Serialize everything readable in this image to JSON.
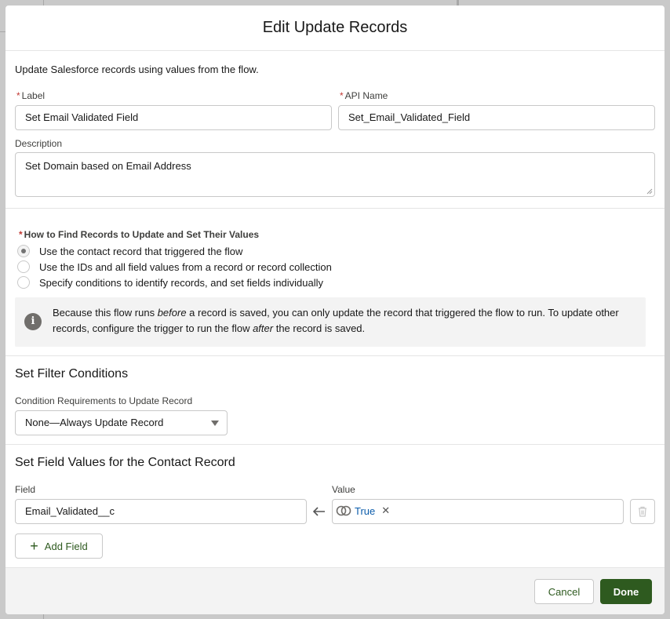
{
  "modal": {
    "title": "Edit Update Records"
  },
  "intro": "Update Salesforce records using values from the flow.",
  "form": {
    "required_mark": "*",
    "label_label": "Label",
    "label_value": "Set Email Validated Field",
    "api_label": "API Name",
    "api_value": "Set_Email_Validated_Field",
    "description_label": "Description",
    "description_value": "Set Domain based on Email Address"
  },
  "find": {
    "label": "How to Find Records to Update and Set Their Values",
    "options": [
      {
        "text": "Use the contact record that triggered the flow",
        "selected": true
      },
      {
        "text": "Use the IDs and all field values from a record or record collection",
        "selected": false
      },
      {
        "text": "Specify conditions to identify records, and set fields individually",
        "selected": false
      }
    ],
    "info_icon": "info-icon",
    "info_pre": "Because this flow runs ",
    "info_em1": "before",
    "info_mid": " a record is saved, you can only update the record that triggered the flow to run. To update other records, configure the trigger to run the flow ",
    "info_em2": "after",
    "info_post": " the record is saved."
  },
  "filter": {
    "title": "Set Filter Conditions",
    "req_label": "Condition Requirements to Update Record",
    "req_value": "None—Always Update Record"
  },
  "fields": {
    "title": "Set Field Values for the Contact Record",
    "field_label": "Field",
    "value_label": "Value",
    "field_value": "Email_Validated__c",
    "value_pill": "True",
    "add_label": "Add Field"
  },
  "footer": {
    "cancel": "Cancel",
    "done": "Done"
  },
  "colors": {
    "brand_button": "#2e5a1f",
    "required": "#c23934",
    "link": "#0b5cab"
  }
}
